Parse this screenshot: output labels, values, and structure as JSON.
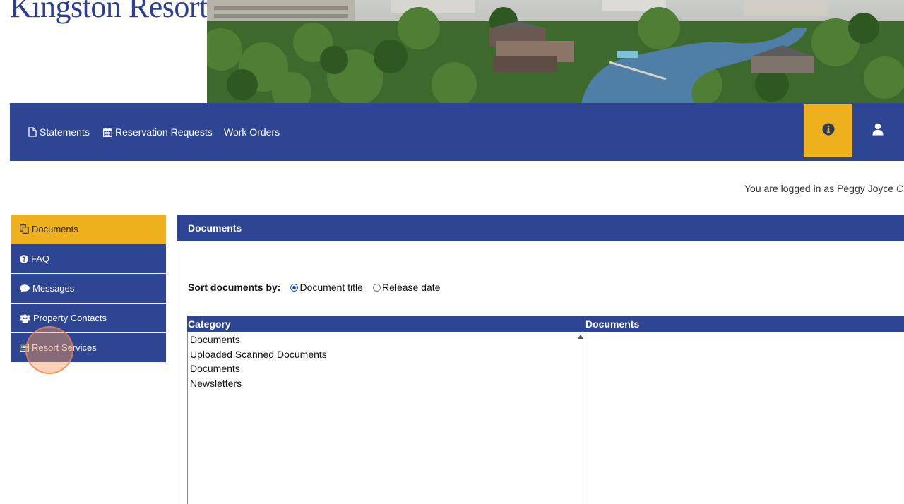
{
  "brand": {
    "name": "Kingston Resorts",
    "mark": "®"
  },
  "topnav": {
    "items": [
      {
        "label": "Statements",
        "icon": "file-icon"
      },
      {
        "label": "Reservation Requests",
        "icon": "calendar-icon"
      },
      {
        "label": "Work Orders"
      }
    ],
    "info_icon": "info-circle-icon",
    "user_icon": "user-icon"
  },
  "session": {
    "logged_in_text": "You are logged in as Peggy Joyce C"
  },
  "sidebar": {
    "items": [
      {
        "label": "Documents",
        "icon": "copy-icon",
        "active": true
      },
      {
        "label": "FAQ",
        "icon": "question-circle-icon"
      },
      {
        "label": "Messages",
        "icon": "comment-icon"
      },
      {
        "label": "Property Contacts",
        "icon": "users-icon"
      },
      {
        "label": "Resort Services",
        "icon": "list-alt-icon"
      }
    ]
  },
  "panel": {
    "title": "Documents",
    "sort": {
      "label": "Sort documents by:",
      "options": [
        {
          "label": "Document title",
          "selected": true
        },
        {
          "label": "Release date",
          "selected": false
        }
      ]
    },
    "grid": {
      "headers": [
        "Category",
        "Documents"
      ],
      "categories": [
        "Documents",
        "Uploaded Scanned Documents",
        "Documents",
        "Newsletters"
      ]
    }
  },
  "colors": {
    "nav_blue": "#2e4593",
    "accent_yellow": "#eeb11d",
    "brand_text": "#2b3e94"
  }
}
